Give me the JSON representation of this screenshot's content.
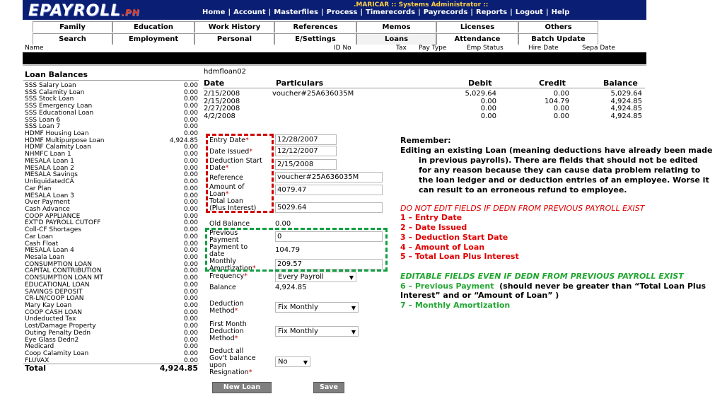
{
  "header": {
    "logo_main": "EPAYROLL",
    "logo_suffix": ".PH",
    "user_line": ".MARICAR :: Systems Administrator ::",
    "nav": [
      "Home",
      "Account",
      "Masterfiles",
      "Process",
      "Timerecords",
      "Payrecords",
      "Reports",
      "Logout",
      "Help"
    ]
  },
  "tabs_row1": [
    "Family",
    "Education",
    "Work History",
    "References",
    "Memos",
    "Licenses",
    "Others"
  ],
  "tabs_row2": [
    "Search",
    "Employment",
    "Personal",
    "E/Settings",
    "Loans",
    "Attendance",
    "Batch Update"
  ],
  "employee_header": {
    "name": "Name",
    "id_no": "ID No",
    "tax": "Tax",
    "pay_type": "Pay Type",
    "emp_status": "Emp Status",
    "hire_date": "Hire Date",
    "sepa_date": "Sepa Date"
  },
  "loan_balances": {
    "title": "Loan Balances",
    "items": [
      {
        "name": "SSS Salary Loan",
        "value": "0.00"
      },
      {
        "name": "SSS Calamity Loan",
        "value": "0.00"
      },
      {
        "name": "SSS Stock Loan",
        "value": "0.00"
      },
      {
        "name": "SSS Emergency Loan",
        "value": "0.00"
      },
      {
        "name": "SSS Educational Loan",
        "value": "0.00"
      },
      {
        "name": "SSS Loan 6",
        "value": "0.00"
      },
      {
        "name": "SSS Loan 7",
        "value": "0.00"
      },
      {
        "name": "HDMF Housing Loan",
        "value": "0.00"
      },
      {
        "name": "HDMF Multipurpose Loan",
        "value": "4,924.85"
      },
      {
        "name": "HDMF Calamity Loan",
        "value": "0.00"
      },
      {
        "name": "NHMFC Loan 1",
        "value": "0.00"
      },
      {
        "name": "MESALA Loan 1",
        "value": "0.00"
      },
      {
        "name": "MESALA Loan 2",
        "value": "0.00"
      },
      {
        "name": "MESALA Savings",
        "value": "0.00"
      },
      {
        "name": "UnliquidatedCA",
        "value": "0.00"
      },
      {
        "name": "Car Plan",
        "value": "0.00"
      },
      {
        "name": "MESALA Loan 3",
        "value": "0.00"
      },
      {
        "name": "Over Payment",
        "value": "0.00"
      },
      {
        "name": "Cash Advance",
        "value": "0.00"
      },
      {
        "name": "COOP APPLIANCE",
        "value": "0.00"
      },
      {
        "name": "EXT'D PAYROLL CUTOFF",
        "value": "0.00"
      },
      {
        "name": "Coll-CF Shortages",
        "value": "0.00"
      },
      {
        "name": "Car Loan",
        "value": "0.00"
      },
      {
        "name": "Cash Float",
        "value": "0.00"
      },
      {
        "name": "MESALA Loan 4",
        "value": "0.00"
      },
      {
        "name": "Mesala Loan",
        "value": "0.00"
      },
      {
        "name": "CONSUMPTION LOAN",
        "value": "0.00"
      },
      {
        "name": "CAPITAL CONTRIBUTION",
        "value": "0.00"
      },
      {
        "name": "CONSUMPTION LOAN MT",
        "value": "0.00"
      },
      {
        "name": "EDUCATIONAL LOAN",
        "value": "0.00"
      },
      {
        "name": "SAVINGS DEPOSIT",
        "value": "0.00"
      },
      {
        "name": "CR-LN/COOP LOAN",
        "value": "0.00"
      },
      {
        "name": "Mary Kay Loan",
        "value": "0.00"
      },
      {
        "name": "COOP CASH LOAN",
        "value": "0.00"
      },
      {
        "name": "Undeducted Tax",
        "value": "0.00"
      },
      {
        "name": "Lost/Damage Property",
        "value": "0.00"
      },
      {
        "name": "Outing Penalty Dedn",
        "value": "0.00"
      },
      {
        "name": "Eye Glass Dedn2",
        "value": "0.00"
      },
      {
        "name": "Medicard",
        "value": "0.00"
      },
      {
        "name": "Coop Calamity Loan",
        "value": "0.00"
      },
      {
        "name": "FLUVAX",
        "value": "0.00"
      }
    ],
    "total_label": "Total",
    "total_value": "4,924.85"
  },
  "ledger": {
    "title": "hdmfloan02",
    "headers": {
      "date": "Date",
      "particulars": "Particulars",
      "debit": "Debit",
      "credit": "Credit",
      "balance": "Balance"
    },
    "rows": [
      {
        "date": "2/15/2008",
        "particulars": "voucher#25A636035M",
        "debit": "5,029.64",
        "credit": "0.00",
        "balance": "5,029.64"
      },
      {
        "date": "2/15/2008",
        "particulars": "",
        "debit": "0.00",
        "credit": "104.79",
        "balance": "4,924.85"
      },
      {
        "date": "2/27/2008",
        "particulars": "",
        "debit": "0.00",
        "credit": "0.00",
        "balance": "4,924.85"
      },
      {
        "date": "4/2/2008",
        "particulars": "",
        "debit": "0.00",
        "credit": "0.00",
        "balance": "4,924.85"
      }
    ]
  },
  "form": {
    "entry_date": {
      "label": "Entry Date",
      "value": "12/28/2007"
    },
    "date_issued": {
      "label": "Date Issued",
      "value": "12/12/2007"
    },
    "deduction_start": {
      "label1": "Deduction Start",
      "label2": "Date",
      "value": "2/15/2008"
    },
    "reference": {
      "label": "Reference",
      "value": "voucher#25A636035M"
    },
    "amount_of_loan": {
      "label1": "Amount of",
      "label2": "Loan",
      "value": "4079.47"
    },
    "total_loan": {
      "label1": "Total Loan",
      "label2": "(Plus Interest)",
      "value": "5029.64"
    },
    "old_balance": {
      "label": "Old Balance",
      "value": "0.00"
    },
    "previous_payment": {
      "label1": "Previous",
      "label2": "Payment",
      "value": "0"
    },
    "payment_to_date": {
      "label1": "Payment to",
      "label2": "date",
      "value": "104.79"
    },
    "monthly_amort": {
      "label1": "Monthly",
      "label2": "Amortization",
      "value": "209.57"
    },
    "frequency": {
      "label": "Frequency",
      "value": "Every Payroll"
    },
    "balance": {
      "label": "Balance",
      "value": "4,924.85"
    },
    "deduction_method": {
      "label1": "Deduction",
      "label2": "Method",
      "value": "Fix Monthly"
    },
    "first_month": {
      "label1": "First Month",
      "label2": "Deduction",
      "label3": "Method",
      "value": "Fix Monthly"
    },
    "deduct_all": {
      "label1": "Deduct all",
      "label2": "Gov't balance",
      "label3": "upon",
      "label4": "Resignation",
      "value": "No"
    },
    "new_loan_button": "New Loan",
    "save_button": "Save",
    "required_mark": "*"
  },
  "notes": {
    "remember": "Remember:",
    "para_lines": [
      "Editing an existing Loan (meaning deductions have already been made",
      "in previous payrolls).  There are fields that should not be edited",
      "for any reason because they can cause data problem relating to",
      "the loan ledger and or deduction entries of an employee.  Worse it",
      "can result to an erroneous refund to employee."
    ],
    "red_title": "DO NOT EDIT FIELDS IF DEDN FROM PREVIOUS PAYROLL EXIST",
    "red_items": [
      "1 – Entry Date",
      "2 – Date Issued",
      "3 – Deduction Start Date",
      "4 – Amount of Loan",
      "5 – Total Loan Plus Interest"
    ],
    "green_title": "EDITABLE FIELDS  EVEN IF  DEDN FROM PREVIOUS PAYROLL EXIST",
    "green_item6": "6 – Previous Payment",
    "item6_note_a": "(should never be greater than “Total Loan Plus",
    "item6_note_b": "Interest” and or “Amount of Loan” )",
    "green_item7": "7 – Monthly Amortization"
  },
  "colors": {
    "header_bg": "#0a1f73",
    "red": "#e00000",
    "green": "#22a632",
    "button": "#808080"
  }
}
